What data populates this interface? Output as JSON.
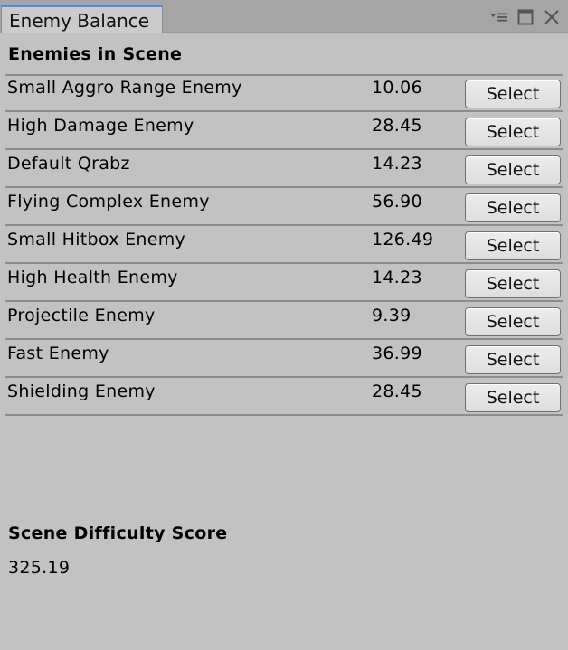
{
  "window": {
    "tab_title": "Enemy Balance",
    "accent_color": "#4f8ee8",
    "controls": [
      {
        "name": "context-menu-icon"
      },
      {
        "name": "maximize-icon"
      },
      {
        "name": "close-icon"
      }
    ]
  },
  "enemies_section": {
    "title": "Enemies in Scene",
    "button_label": "Select",
    "rows": [
      {
        "name": "Small Aggro Range Enemy",
        "score": "10.06"
      },
      {
        "name": "High Damage Enemy",
        "score": "28.45"
      },
      {
        "name": "Default Qrabz",
        "score": "14.23"
      },
      {
        "name": "Flying Complex Enemy",
        "score": "56.90"
      },
      {
        "name": "Small Hitbox Enemy",
        "score": "126.49"
      },
      {
        "name": "High Health Enemy",
        "score": "14.23"
      },
      {
        "name": "Projectile Enemy",
        "score": "9.39"
      },
      {
        "name": "Fast Enemy",
        "score": "36.99"
      },
      {
        "name": "Shielding Enemy",
        "score": "28.45"
      }
    ]
  },
  "difficulty_section": {
    "title": "Scene Difficulty Score",
    "value": "325.19"
  }
}
